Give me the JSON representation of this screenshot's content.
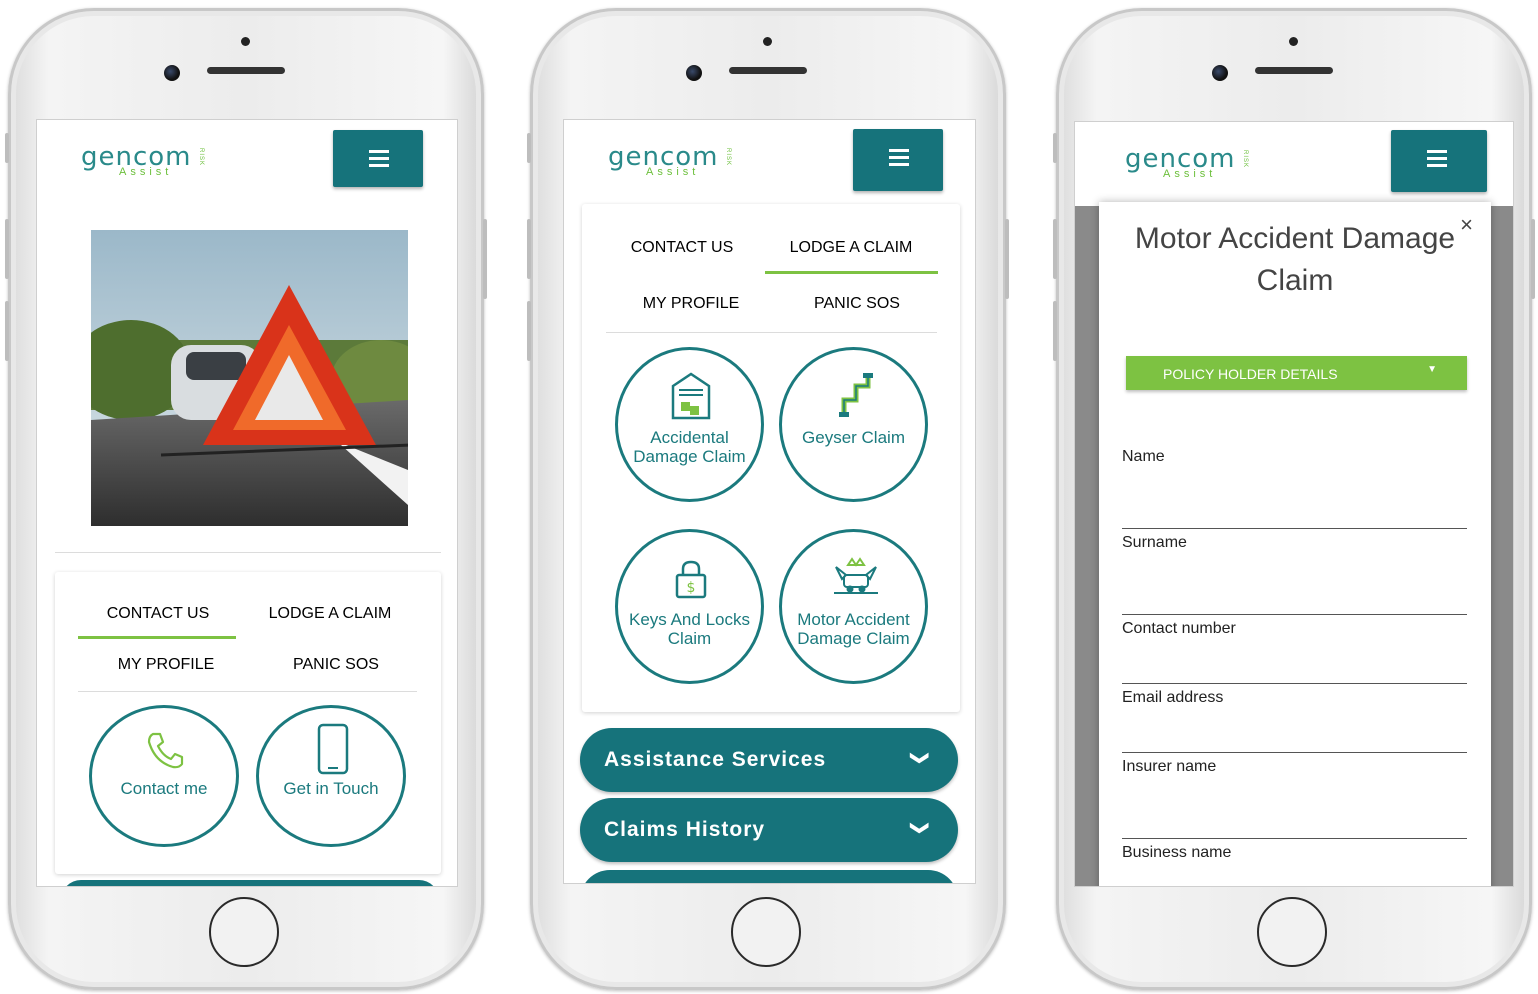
{
  "brand": {
    "logo_text": "gencom",
    "logo_sub": "Assist",
    "logo_risk": "RISK"
  },
  "phone1": {
    "tabs": [
      "CONTACT US",
      "LODGE A CLAIM",
      "MY PROFILE",
      "PANIC SOS"
    ],
    "active_tab": "CONTACT US",
    "actions": [
      {
        "label": "Contact me",
        "icon": "phone-icon"
      },
      {
        "label": "Get in Touch",
        "icon": "smartphone-icon"
      }
    ]
  },
  "phone2": {
    "tabs": [
      "CONTACT US",
      "LODGE A CLAIM",
      "MY PROFILE",
      "PANIC SOS"
    ],
    "active_tab": "LODGE A CLAIM",
    "claims": [
      {
        "label": "Accidental Damage Claim",
        "icon": "garage-icon"
      },
      {
        "label": "Geyser Claim",
        "icon": "pipe-icon"
      },
      {
        "label": "Keys And Locks Claim",
        "icon": "padlock-dollar-icon"
      },
      {
        "label": "Motor Accident Damage Claim",
        "icon": "car-crash-icon"
      }
    ],
    "accordions": [
      {
        "label": "Assistance Services",
        "icon": "chevron-down-icon"
      },
      {
        "label": "Claims History",
        "icon": "chevron-down-icon"
      }
    ]
  },
  "phone3": {
    "modal_title": "Motor Accident Damage Claim",
    "close_symbol": "×",
    "section_dropdown": "POLICY HOLDER DETAILS",
    "fields": [
      "Name",
      "Surname",
      "Contact number",
      "Email address",
      "Insurer name",
      "Business name"
    ]
  },
  "colors": {
    "teal": "#16737b",
    "green": "#7dc242"
  }
}
